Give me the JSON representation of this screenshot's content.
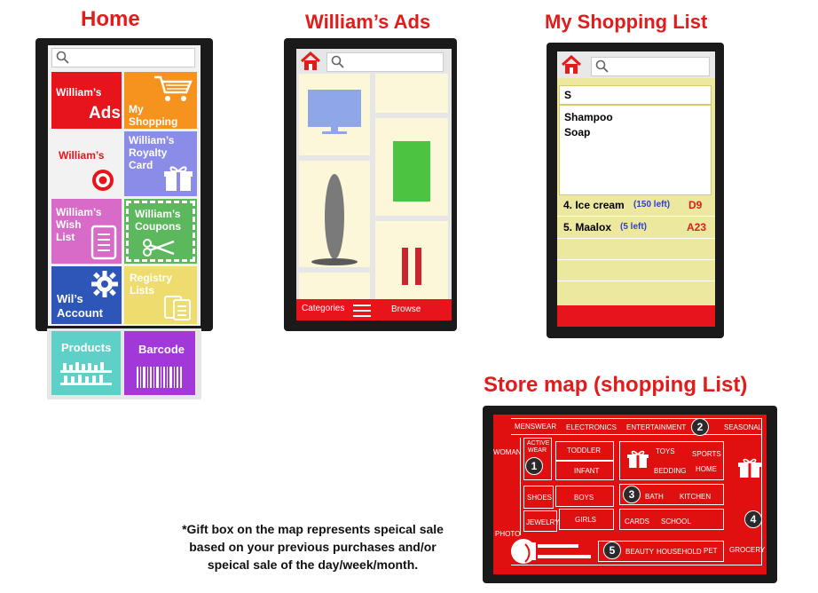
{
  "titles": {
    "home": "Home",
    "ads": "William’s Ads",
    "list": "My Shopping List",
    "map": "Store map (shopping List)"
  },
  "home": {
    "tiles": {
      "william_ads": [
        "William’s",
        "Ads"
      ],
      "shopping_list": [
        "My",
        "Shopping List"
      ],
      "william_target": "William’s",
      "royalty": [
        "William’s",
        "Royalty",
        "Card"
      ],
      "wish": [
        "William’s",
        "Wish",
        "List"
      ],
      "coupons": [
        "William’s",
        "Coupons"
      ],
      "account": [
        "Wil’s",
        "Account"
      ],
      "registry": [
        "Registry",
        "Lists"
      ],
      "products": "Products",
      "barcode": "Barcode"
    }
  },
  "ads": {
    "categories": "Categories",
    "browse": "Browse"
  },
  "list": {
    "search_value": "S",
    "suggestions": [
      "Shampoo",
      "Soap"
    ],
    "items": [
      {
        "name": "4. Ice cream",
        "left": "(150 left)",
        "aisle": "D9"
      },
      {
        "name": "5. Maalox",
        "left": "(5 left)",
        "aisle": "A23"
      }
    ]
  },
  "map": {
    "top": [
      "MENSWEAR",
      "ELECTRONICS",
      "ENTERTAINMENT",
      "SEASONAL"
    ],
    "left": [
      "WOMAN",
      "PHOTO"
    ],
    "active": [
      "ACTIVE",
      "WEAR"
    ],
    "toddler": "TODDLER",
    "infant": "INFANT",
    "toys": "TOYS",
    "sports": "SPORTS",
    "bedding": "BEDDING",
    "home": "HOME",
    "shoes": "SHOES",
    "boys": "BOYS",
    "bath": "BATH",
    "kitchen": "KITCHEN",
    "jewelry": "JEWELRY",
    "girls": "GIRLS",
    "cards": "CARDS",
    "school": "SCHOOL",
    "beauty": "BEAUTY",
    "household": "HOUSEHOLD",
    "pet": "PET",
    "grocery": "GROCERY",
    "numbers": [
      "1",
      "2",
      "3",
      "4",
      "5"
    ]
  },
  "note": [
    "*Gift box on the map represents speical sale",
    "based on your previous purchases and/or",
    "speical sale of the day/week/month."
  ],
  "colors": {
    "brand_red": "#e21b1b",
    "ads_tile": "#e8141c",
    "shopping_tile": "#f6921e",
    "royalty_tile": "#8b8ce8",
    "wish_tile": "#d86ac8",
    "coupons_tile": "#5cb85c",
    "account_tile": "#2e56b8",
    "registry_tile": "#eedc6e",
    "products_tile": "#5fd0c8",
    "barcode_tile": "#a238d8"
  }
}
